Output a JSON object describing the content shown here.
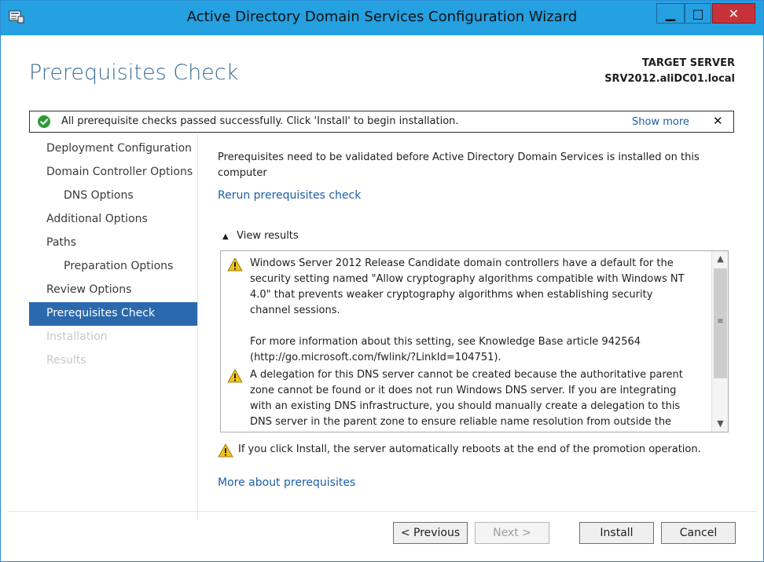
{
  "window": {
    "title": "Active Directory Domain Services Configuration Wizard",
    "controls": {
      "minimize": "▁",
      "maximize": "□",
      "close": "✕"
    }
  },
  "header": {
    "page_title": "Prerequisites Check",
    "target_label": "TARGET SERVER",
    "target_name": "SRV2012.aliDC01.local"
  },
  "banner": {
    "message": "All prerequisite checks passed successfully.  Click 'Install' to begin installation.",
    "show_more": "Show more",
    "close": "✕",
    "icon": "success-check-icon",
    "color": "#2d9a38"
  },
  "nav": {
    "items": [
      {
        "label": "Deployment Configuration",
        "state": "normal"
      },
      {
        "label": "Domain Controller Options",
        "state": "normal"
      },
      {
        "label": "DNS Options",
        "state": "normal"
      },
      {
        "label": "Additional Options",
        "state": "normal"
      },
      {
        "label": "Paths",
        "state": "normal"
      },
      {
        "label": "Preparation Options",
        "state": "normal"
      },
      {
        "label": "Review Options",
        "state": "normal"
      },
      {
        "label": "Prerequisites Check",
        "state": "selected"
      },
      {
        "label": "Installation",
        "state": "disabled"
      },
      {
        "label": "Results",
        "state": "disabled"
      }
    ]
  },
  "content": {
    "intro": "Prerequisites need to be validated before Active Directory Domain Services is installed on this computer",
    "rerun_link": "Rerun prerequisites check",
    "view_results_chevron": "▲",
    "view_results": "View results",
    "results": [
      {
        "icon": "warning-icon",
        "text_1": "Windows Server 2012 Release Candidate domain controllers have a default for the security setting named \"Allow cryptography algorithms compatible with Windows NT 4.0\" that prevents weaker cryptography algorithms when establishing security channel sessions.",
        "text_2": "For more information about this setting, see Knowledge Base article 942564 (http://go.microsoft.com/fwlink/?LinkId=104751)."
      },
      {
        "icon": "warning-icon",
        "text_1": "A delegation for this DNS server cannot be created because the authoritative parent zone cannot be found or it does not run Windows DNS server. If you are integrating with an existing DNS infrastructure, you should manually create a delegation to this DNS server in the parent zone to ensure reliable name resolution from outside the"
      }
    ],
    "scroll": {
      "up": "▲",
      "down": "▼",
      "grip": "≡"
    },
    "reboot_warning": "If you click Install, the server automatically reboots at the end of the promotion operation.",
    "more_link": "More about prerequisites"
  },
  "footer": {
    "previous": "< Previous",
    "next": "Next >",
    "install": "Install",
    "cancel": "Cancel"
  },
  "colors": {
    "titlebar": "#25a0e0",
    "accent": "#2a69ad",
    "link": "#1c5fa5",
    "warning": "#f2c21b",
    "close_button": "#c7323a"
  }
}
